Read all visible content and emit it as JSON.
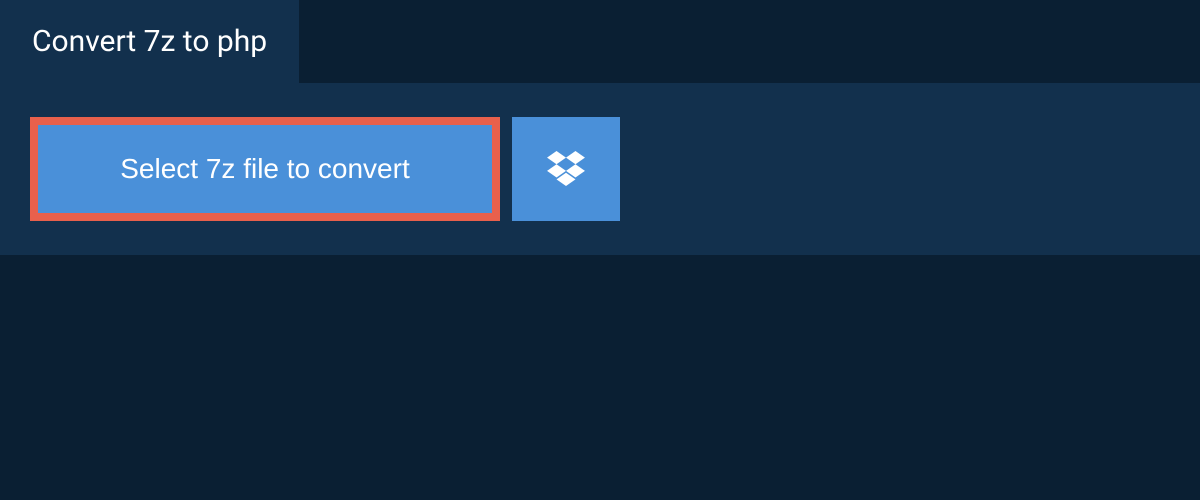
{
  "tab": {
    "title": "Convert 7z to php"
  },
  "actions": {
    "select_file_label": "Select 7z file to convert"
  }
}
